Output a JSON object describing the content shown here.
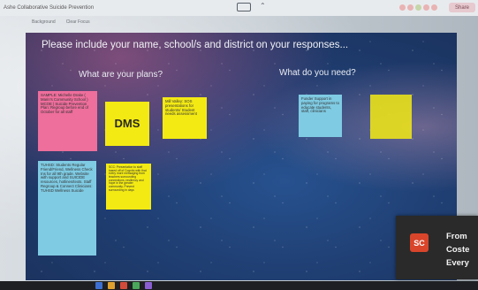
{
  "app": {
    "title": "Ashe Collaborative Suicide Prevention",
    "menu": [
      "Background",
      "Clear Focus"
    ],
    "toolbar_button": "Share"
  },
  "board": {
    "heading": "Please include your name, school/s and district on your responses...",
    "columns": {
      "plans": "What are your plans?",
      "need": "What do you need?"
    },
    "notes": {
      "sample": "SAMPLE: Michelle Drake ( Marin's Community School ) MCOE | Suicide Prevention Plan: Regroup before end of October for all staff",
      "dms": "DMS",
      "mill_valley": "Mill Valley: SOS presentations for students/ Student needs assessment",
      "tuhsd": "TUHSD: Students Regular Friend/Friend, Wellness Check Ins for all 9th grade. Website with support and SUICIDE resources, hotlines/texts. Staff Regroup & Connect Clinicians: TUHSD Wellness Suicide",
      "scc": "SCC: Presentation to staff based off of Cognito with that every more messaging from teachers surrounding connections, resiliency and hope in the greater community. Prevent surrounding in days",
      "need_blue": "Funder Support in paying for programs to educate students, staff, clinicians",
      "need_yellow": ""
    }
  },
  "toast": {
    "avatar": "SC",
    "lines": [
      "From",
      "Coste",
      "Every"
    ]
  },
  "colors": {
    "pink": "#ee6e9c",
    "yellow": "#f3ea14",
    "blue": "#7fcbe3",
    "avatar": "#d9452b"
  }
}
